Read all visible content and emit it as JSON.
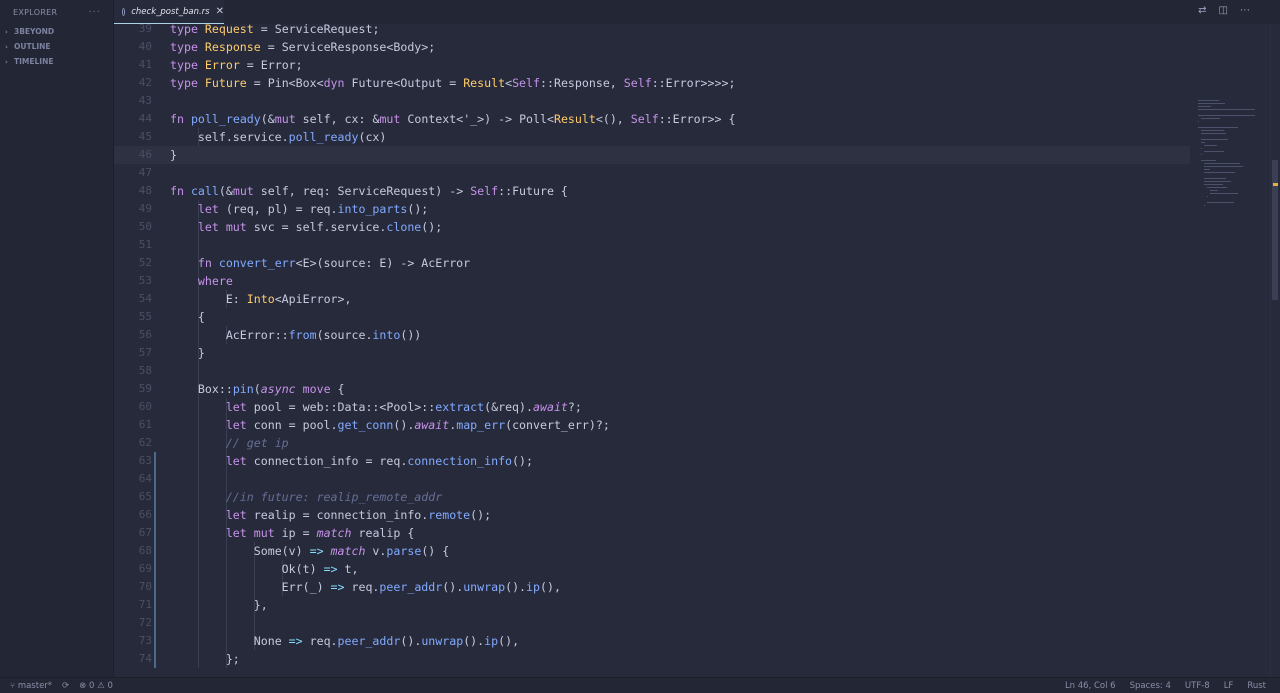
{
  "sidebar": {
    "title": "EXPLORER",
    "more": "···",
    "sections": [
      {
        "label": "3BEYOND"
      },
      {
        "label": "OUTLINE"
      },
      {
        "label": "TIMELINE"
      }
    ]
  },
  "tab": {
    "label": "check_post_ban.rs",
    "close": "✕"
  },
  "status": {
    "branch": "master*",
    "errors": "0",
    "warnings": "0",
    "position": "Ln 46, Col 6",
    "spaces": "Spaces: 4",
    "encoding": "UTF-8",
    "eol": "LF",
    "language": "Rust"
  },
  "colors": {
    "accent": "#a9d4e8",
    "modified": "#4a6a8e",
    "background": "#262a3a"
  },
  "editor": {
    "lines": [
      {
        "n": "39",
        "indent": 1,
        "tokens": [
          [
            "kw",
            "type "
          ],
          [
            "ty",
            "Request"
          ],
          [
            "pl",
            " = ServiceRequest;"
          ]
        ]
      },
      {
        "n": "40",
        "indent": 1,
        "tokens": [
          [
            "kw",
            "type "
          ],
          [
            "ty",
            "Response"
          ],
          [
            "pl",
            " = ServiceResponse<Body>;"
          ]
        ]
      },
      {
        "n": "41",
        "indent": 1,
        "tokens": [
          [
            "kw",
            "type "
          ],
          [
            "ty",
            "Error"
          ],
          [
            "pl",
            " = Error;"
          ]
        ]
      },
      {
        "n": "42",
        "indent": 1,
        "tokens": [
          [
            "kw",
            "type "
          ],
          [
            "ty",
            "Future"
          ],
          [
            "pl",
            " = Pin<Box<"
          ],
          [
            "kw",
            "dyn"
          ],
          [
            "pl",
            " Future<Output = "
          ],
          [
            "ty",
            "Result"
          ],
          [
            "pl",
            "<"
          ],
          [
            "kw",
            "Self"
          ],
          [
            "pl",
            "::Response, "
          ],
          [
            "kw",
            "Self"
          ],
          [
            "pl",
            "::Error>>>>;"
          ]
        ]
      },
      {
        "n": "43",
        "indent": 1,
        "tokens": []
      },
      {
        "n": "44",
        "indent": 1,
        "tokens": [
          [
            "kw",
            "fn "
          ],
          [
            "fn",
            "poll_ready"
          ],
          [
            "pl",
            "(&"
          ],
          [
            "kw",
            "mut"
          ],
          [
            "pl",
            " self, cx: &"
          ],
          [
            "kw",
            "mut"
          ],
          [
            "pl",
            " Context<'_>) -> Poll<"
          ],
          [
            "ty",
            "Result"
          ],
          [
            "pl",
            "<(), "
          ],
          [
            "kw",
            "Self"
          ],
          [
            "pl",
            "::Error>> {"
          ]
        ]
      },
      {
        "n": "45",
        "indent": 2,
        "tokens": [
          [
            "pl",
            "self.service."
          ],
          [
            "fn",
            "poll_ready"
          ],
          [
            "pl",
            "(cx)"
          ]
        ]
      },
      {
        "n": "46",
        "indent": 1,
        "current": true,
        "tokens": [
          [
            "pl",
            "}"
          ]
        ]
      },
      {
        "n": "47",
        "indent": 1,
        "tokens": []
      },
      {
        "n": "48",
        "indent": 1,
        "tokens": [
          [
            "kw",
            "fn "
          ],
          [
            "fn",
            "call"
          ],
          [
            "pl",
            "(&"
          ],
          [
            "kw",
            "mut"
          ],
          [
            "pl",
            " self, req: ServiceRequest) -> "
          ],
          [
            "kw",
            "Self"
          ],
          [
            "pl",
            "::Future {"
          ]
        ]
      },
      {
        "n": "49",
        "indent": 2,
        "tokens": [
          [
            "kw",
            "let"
          ],
          [
            "pl",
            " (req, pl) = req."
          ],
          [
            "fn",
            "into_parts"
          ],
          [
            "pl",
            "();"
          ]
        ]
      },
      {
        "n": "50",
        "indent": 2,
        "tokens": [
          [
            "kw",
            "let mut"
          ],
          [
            "pl",
            " svc = self.service."
          ],
          [
            "fn",
            "clone"
          ],
          [
            "pl",
            "();"
          ]
        ]
      },
      {
        "n": "51",
        "indent": 2,
        "tokens": []
      },
      {
        "n": "52",
        "indent": 2,
        "tokens": [
          [
            "kw",
            "fn "
          ],
          [
            "fn",
            "convert_err"
          ],
          [
            "pl",
            "<E>(source: E) -> AcError"
          ]
        ]
      },
      {
        "n": "53",
        "indent": 2,
        "tokens": [
          [
            "kw",
            "where"
          ]
        ]
      },
      {
        "n": "54",
        "indent": 3,
        "tokens": [
          [
            "pl",
            "E: "
          ],
          [
            "ty",
            "Into"
          ],
          [
            "pl",
            "<ApiError>,"
          ]
        ]
      },
      {
        "n": "55",
        "indent": 2,
        "tokens": [
          [
            "pl",
            "{"
          ]
        ]
      },
      {
        "n": "56",
        "indent": 3,
        "tokens": [
          [
            "pl",
            "AcError::"
          ],
          [
            "fn",
            "from"
          ],
          [
            "pl",
            "(source."
          ],
          [
            "fn",
            "into"
          ],
          [
            "pl",
            "())"
          ]
        ]
      },
      {
        "n": "57",
        "indent": 2,
        "tokens": [
          [
            "pl",
            "}"
          ]
        ]
      },
      {
        "n": "58",
        "indent": 2,
        "tokens": []
      },
      {
        "n": "59",
        "indent": 2,
        "tokens": [
          [
            "pl",
            "Box::"
          ],
          [
            "fn",
            "pin"
          ],
          [
            "pl",
            "("
          ],
          [
            "kwi",
            "async"
          ],
          [
            "kw",
            " move"
          ],
          [
            "pl",
            " {"
          ]
        ]
      },
      {
        "n": "60",
        "indent": 3,
        "tokens": [
          [
            "kw",
            "let"
          ],
          [
            "pl",
            " pool = web::Data::<Pool>::"
          ],
          [
            "fn",
            "extract"
          ],
          [
            "pl",
            "(&req)."
          ],
          [
            "kwi",
            "await"
          ],
          [
            "pl",
            "?;"
          ]
        ]
      },
      {
        "n": "61",
        "indent": 3,
        "tokens": [
          [
            "kw",
            "let"
          ],
          [
            "pl",
            " conn = pool."
          ],
          [
            "fn",
            "get_conn"
          ],
          [
            "pl",
            "()."
          ],
          [
            "kwi",
            "await"
          ],
          [
            "pl",
            "."
          ],
          [
            "fn",
            "map_err"
          ],
          [
            "pl",
            "(convert_err)?;"
          ]
        ]
      },
      {
        "n": "62",
        "indent": 3,
        "tokens": [
          [
            "cm",
            "// get ip"
          ]
        ]
      },
      {
        "n": "63",
        "indent": 3,
        "git": true,
        "tokens": [
          [
            "kw",
            "let"
          ],
          [
            "pl",
            " connection_info = req."
          ],
          [
            "fn",
            "connection_info"
          ],
          [
            "pl",
            "();"
          ]
        ]
      },
      {
        "n": "64",
        "indent": 3,
        "git": true,
        "tokens": []
      },
      {
        "n": "65",
        "indent": 3,
        "git": true,
        "tokens": [
          [
            "cm",
            "//in future: realip_remote_addr"
          ]
        ]
      },
      {
        "n": "66",
        "indent": 3,
        "git": true,
        "tokens": [
          [
            "kw",
            "let"
          ],
          [
            "pl",
            " realip = connection_info."
          ],
          [
            "fn",
            "remote"
          ],
          [
            "pl",
            "();"
          ]
        ]
      },
      {
        "n": "67",
        "indent": 3,
        "git": true,
        "tokens": [
          [
            "kw",
            "let mut"
          ],
          [
            "pl",
            " ip = "
          ],
          [
            "kwi",
            "match"
          ],
          [
            "pl",
            " realip {"
          ]
        ]
      },
      {
        "n": "68",
        "indent": 4,
        "git": true,
        "tokens": [
          [
            "pl",
            "Some(v) "
          ],
          [
            "op",
            "=>"
          ],
          [
            "kwi",
            " match"
          ],
          [
            "pl",
            " v."
          ],
          [
            "fn",
            "parse"
          ],
          [
            "pl",
            "() {"
          ]
        ]
      },
      {
        "n": "69",
        "indent": 5,
        "git": true,
        "tokens": [
          [
            "pl",
            "Ok(t) "
          ],
          [
            "op",
            "=>"
          ],
          [
            "pl",
            " t,"
          ]
        ]
      },
      {
        "n": "70",
        "indent": 5,
        "git": true,
        "tokens": [
          [
            "pl",
            "Err(_) "
          ],
          [
            "op",
            "=>"
          ],
          [
            "pl",
            " req."
          ],
          [
            "fn",
            "peer_addr"
          ],
          [
            "pl",
            "()."
          ],
          [
            "fn",
            "unwrap"
          ],
          [
            "pl",
            "()."
          ],
          [
            "fn",
            "ip"
          ],
          [
            "pl",
            "(),"
          ]
        ]
      },
      {
        "n": "71",
        "indent": 4,
        "git": true,
        "tokens": [
          [
            "pl",
            "},"
          ]
        ]
      },
      {
        "n": "72",
        "indent": 4,
        "git": true,
        "tokens": []
      },
      {
        "n": "73",
        "indent": 4,
        "git": true,
        "tokens": [
          [
            "pl",
            "None "
          ],
          [
            "op",
            "=>"
          ],
          [
            "pl",
            " req."
          ],
          [
            "fn",
            "peer_addr"
          ],
          [
            "pl",
            "()."
          ],
          [
            "fn",
            "unwrap"
          ],
          [
            "pl",
            "()."
          ],
          [
            "fn",
            "ip"
          ],
          [
            "pl",
            "(),"
          ]
        ]
      },
      {
        "n": "74",
        "indent": 3,
        "git": true,
        "tokens": [
          [
            "pl",
            "};"
          ]
        ]
      }
    ]
  }
}
